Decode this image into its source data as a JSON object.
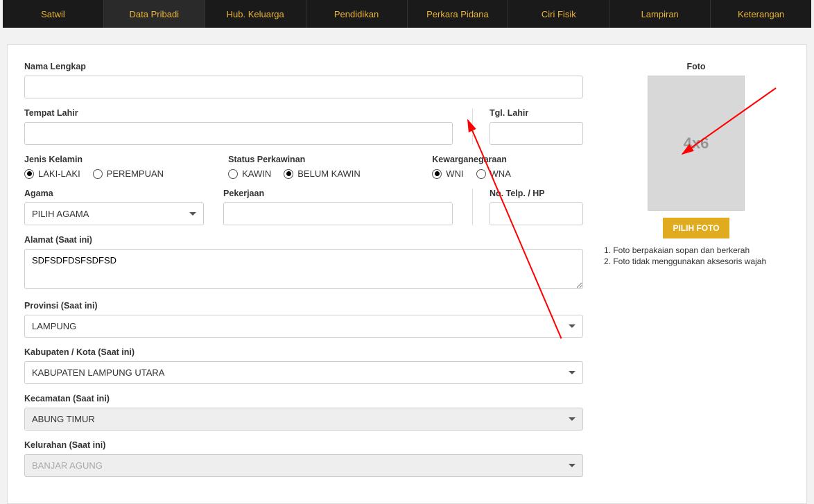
{
  "tabs": {
    "items": [
      "Satwil",
      "Data Pribadi",
      "Hub. Keluarga",
      "Pendidikan",
      "Perkara Pidana",
      "Ciri Fisik",
      "Lampiran",
      "Keterangan"
    ],
    "active_index": 1
  },
  "form": {
    "nama_lengkap_label": "Nama Lengkap",
    "nama_lengkap_value": "",
    "tempat_lahir_label": "Tempat Lahir",
    "tempat_lahir_value": "",
    "tgl_lahir_label": "Tgl. Lahir",
    "tgl_lahir_value": "",
    "jenis_kelamin_label": "Jenis Kelamin",
    "jk_opt1": "LAKI-LAKI",
    "jk_opt2": "PEREMPUAN",
    "jk_selected": "LAKI-LAKI",
    "status_label": "Status Perkawinan",
    "status_opt1": "KAWIN",
    "status_opt2": "BELUM KAWIN",
    "status_selected": "BELUM KAWIN",
    "kewarganegaraan_label": "Kewarganegaraan",
    "kn_opt1": "WNI",
    "kn_opt2": "WNA",
    "kn_selected": "WNI",
    "agama_label": "Agama",
    "agama_value": "PILIH AGAMA",
    "pekerjaan_label": "Pekerjaan",
    "pekerjaan_value": "",
    "telp_label": "No. Telp. / HP",
    "telp_value": "",
    "alamat_label": "Alamat (Saat ini)",
    "alamat_value": "SDFSDFDSFSDFSD",
    "provinsi_label": "Provinsi (Saat ini)",
    "provinsi_value": "LAMPUNG",
    "kabupaten_label": "Kabupaten / Kota (Saat ini)",
    "kabupaten_value": "KABUPATEN LAMPUNG UTARA",
    "kecamatan_label": "Kecamatan (Saat ini)",
    "kecamatan_value": "ABUNG TIMUR",
    "kelurahan_label": "Kelurahan (Saat ini)",
    "kelurahan_value": "BANJAR AGUNG"
  },
  "side": {
    "foto_label": "Foto",
    "placeholder": "4x6",
    "button": "PILIH FOTO",
    "note1": "1.    Foto berpakaian sopan dan berkerah",
    "note2": "2. Foto tidak menggunakan aksesoris wajah"
  }
}
